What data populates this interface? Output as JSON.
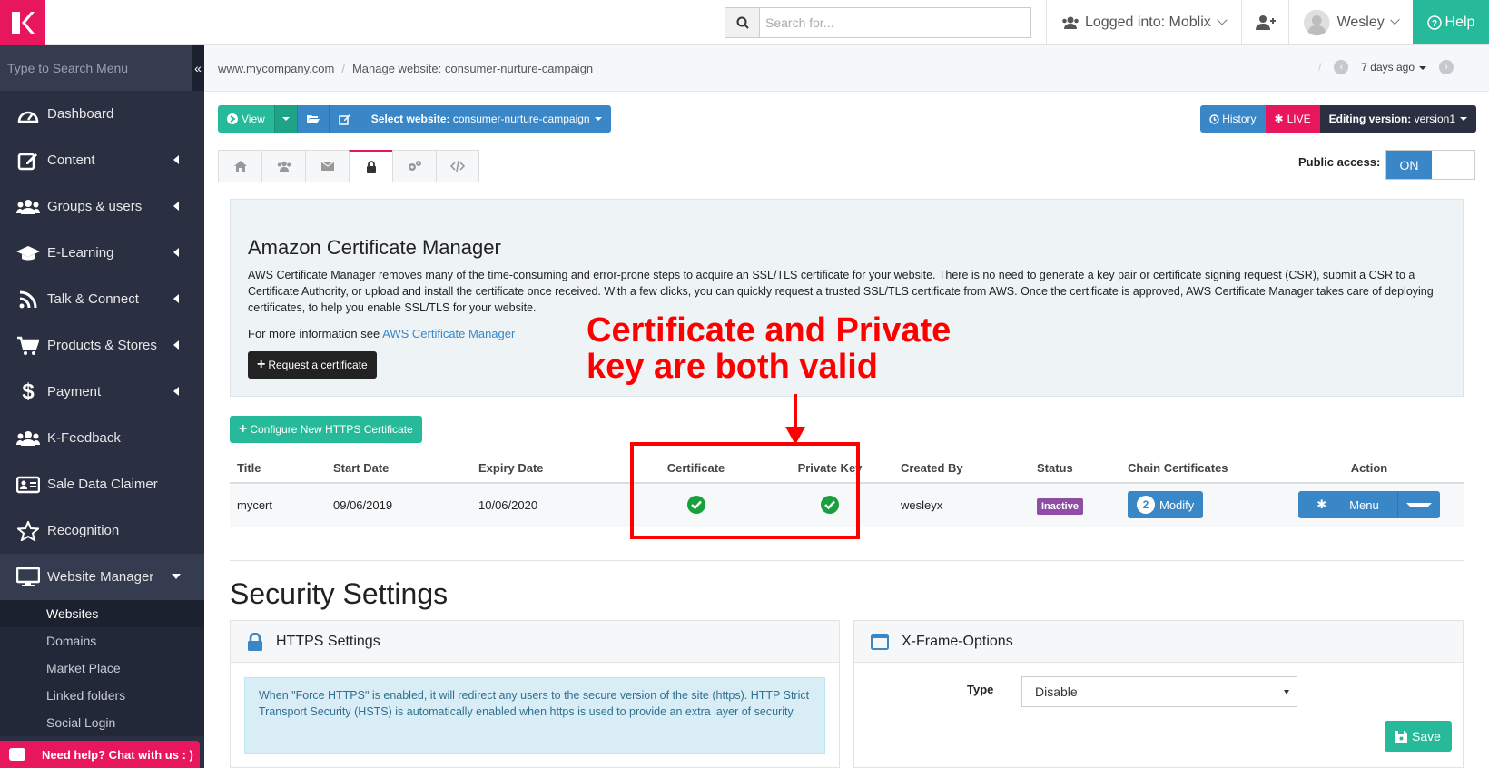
{
  "topbar": {
    "search_placeholder": "Search for...",
    "logged_into": "Logged into: Moblix",
    "user_name": "Wesley",
    "help_label": "Help"
  },
  "sidebar": {
    "search_placeholder": "Type to Search Menu",
    "items": [
      {
        "label": "Dashboard",
        "icon": "dashboard-icon"
      },
      {
        "label": "Content",
        "icon": "edit-icon"
      },
      {
        "label": "Groups & users",
        "icon": "users-icon"
      },
      {
        "label": "E-Learning",
        "icon": "graduation-cap-icon"
      },
      {
        "label": "Talk & Connect",
        "icon": "rss-icon"
      },
      {
        "label": "Products & Stores",
        "icon": "cart-icon"
      },
      {
        "label": "Payment",
        "icon": "dollar-icon"
      },
      {
        "label": "K-Feedback",
        "icon": "users-icon"
      },
      {
        "label": "Sale Data Claimer",
        "icon": "id-card-icon"
      },
      {
        "label": "Recognition",
        "icon": "star-icon"
      },
      {
        "label": "Website Manager",
        "icon": "desktop-icon"
      }
    ],
    "sub_items": [
      "Websites",
      "Domains",
      "Market Place",
      "Linked folders",
      "Social Login"
    ],
    "chat_label": "Need help? Chat with us : )"
  },
  "breadcrumb": {
    "root": "www.mycompany.com",
    "current": "Manage website: consumer-nurture-campaign",
    "time_label": "7 days ago"
  },
  "toolbar": {
    "view_label": "View",
    "select_website_prefix": "Select website:",
    "select_website_value": "consumer-nurture-campaign",
    "history_label": "History",
    "live_label": "LIVE",
    "editing_prefix": "Editing version:",
    "editing_value": "version1"
  },
  "public_access": {
    "label": "Public access:",
    "state": "ON"
  },
  "acm": {
    "title": "Amazon Certificate Manager",
    "description": "AWS Certificate Manager removes many of the time-consuming and error-prone steps to acquire an SSL/TLS certificate for your website. There is no need to generate a key pair or certificate signing request (CSR), submit a CSR to a Certificate Authority, or upload and install the certificate once received. With a few clicks, you can quickly request a trusted SSL/TLS certificate from AWS. Once the certificate is approved, AWS Certificate Manager takes care of deploying certificates, to help you enable SSL/TLS for your website.",
    "more_info_prefix": "For more information see",
    "more_info_link": "AWS Certificate Manager",
    "request_label": "Request a certificate"
  },
  "annotation": {
    "line1": "Certificate and Private",
    "line2": "key are both valid"
  },
  "certs": {
    "configure_label": "Configure New HTTPS Certificate",
    "headers": [
      "Title",
      "Start Date",
      "Expiry Date",
      "Certificate",
      "Private Key",
      "Created By",
      "Status",
      "Chain Certificates",
      "Action"
    ],
    "rows": [
      {
        "title": "mycert",
        "start": "09/06/2019",
        "expiry": "10/06/2020",
        "certificate_valid": true,
        "private_key_valid": true,
        "created_by": "wesleyx",
        "status": "Inactive",
        "chain_count": "2",
        "chain_label": "Modify",
        "action_label": "Menu"
      }
    ]
  },
  "security": {
    "title": "Security Settings",
    "https_title": "HTTPS Settings",
    "https_info": "When \"Force HTTPS\" is enabled, it will redirect any users to the secure version of the site (https). HTTP Strict Transport Security (HSTS) is automatically enabled when https is used to provide an extra layer of security.",
    "xframe_title": "X-Frame-Options",
    "type_label": "Type",
    "type_value": "Disable",
    "save_label": "Save"
  },
  "colors": {
    "brand_pink": "#e8175d",
    "green": "#26b99a",
    "blue": "#3a87c8",
    "sidebar": "#2a3042",
    "annotation_red": "#ff0000"
  }
}
